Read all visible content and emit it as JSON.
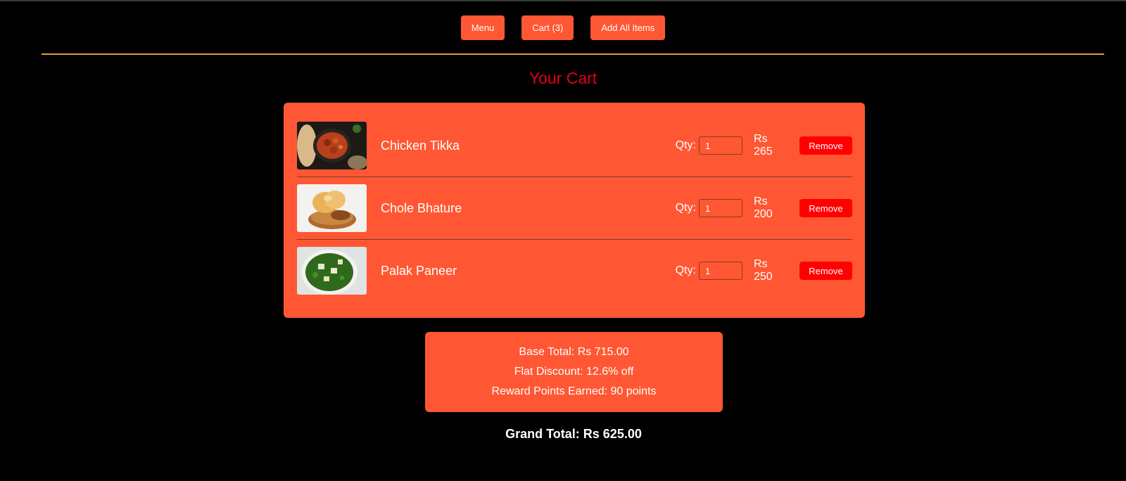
{
  "nav": {
    "menu_label": "Menu",
    "cart_label": "Cart (3)",
    "add_all_label": "Add All Items"
  },
  "page_title": "Your Cart",
  "cart": {
    "qty_label": "Qty:",
    "remove_label": "Remove",
    "items": [
      {
        "name": "Chicken Tikka",
        "qty": "1",
        "price": "Rs 265",
        "image": "chicken-tikka-image"
      },
      {
        "name": "Chole Bhature",
        "qty": "1",
        "price": "Rs 200",
        "image": "chole-bhature-image"
      },
      {
        "name": "Palak Paneer",
        "qty": "1",
        "price": "Rs 250",
        "image": "palak-paneer-image"
      }
    ]
  },
  "summary": {
    "base_total": "Base Total: Rs 715.00",
    "flat_discount": "Flat Discount: 12.6% off",
    "reward_points": "Reward Points Earned: 90 points"
  },
  "grand_total": "Grand Total: Rs 625.00",
  "colors": {
    "accent": "#ff5733",
    "remove": "#ff0000",
    "title": "#e3001b",
    "divider": "#d9a42a",
    "background": "#000000"
  }
}
